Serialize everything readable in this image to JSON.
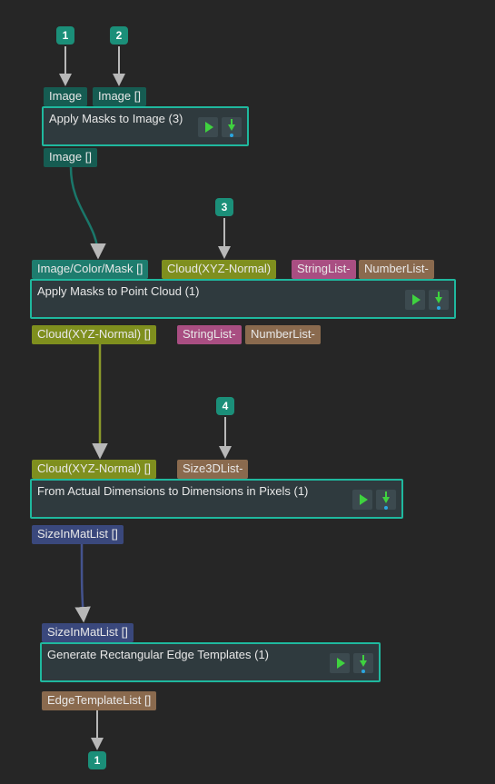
{
  "inputs": {
    "b1": "1",
    "b2": "2",
    "b3": "3",
    "b4": "4"
  },
  "outputs": {
    "o1": "1"
  },
  "ports": {
    "n1_in1": "Image",
    "n1_in2": "Image []",
    "n1_out1": "Image []",
    "n2_in1": "Image/Color/Mask []",
    "n2_in2": "Cloud(XYZ-Normal)",
    "n2_in3": "StringList-",
    "n2_in4": "NumberList-",
    "n2_out1": "Cloud(XYZ-Normal) []",
    "n2_out2": "StringList-",
    "n2_out3": "NumberList-",
    "n3_in1": "Cloud(XYZ-Normal) []",
    "n3_in2": "Size3DList-",
    "n3_out1": "SizeInMatList []",
    "n4_in1": "SizeInMatList []",
    "n4_out1": "EdgeTemplateList []"
  },
  "steps": {
    "s1": "Apply Masks to Image (3)",
    "s2": "Apply Masks to Point Cloud (1)",
    "s3": "From Actual Dimensions to Dimensions in Pixels (1)",
    "s4": "Generate Rectangular Edge Templates (1)"
  }
}
